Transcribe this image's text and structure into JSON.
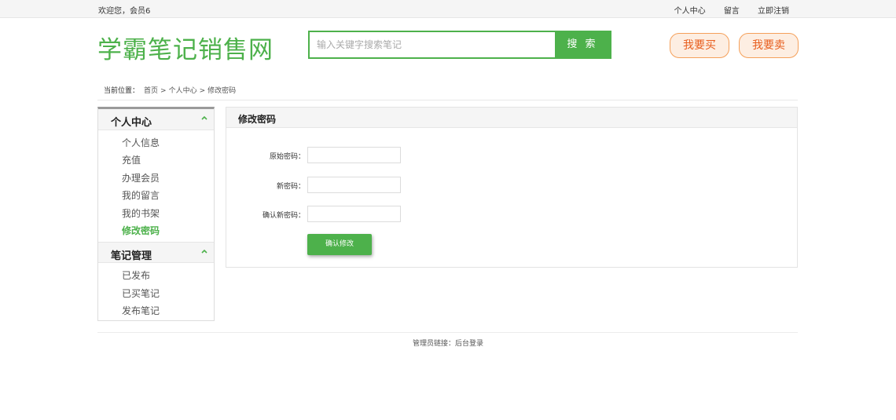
{
  "topbar": {
    "welcome": "欢迎您，会员6",
    "links": [
      "个人中心",
      "留言",
      "立即注销"
    ]
  },
  "header": {
    "logo": "学霸笔记销售网",
    "search_placeholder": "输入关键字搜索笔记",
    "search_button": "搜 索",
    "buy_button": "我要买",
    "sell_button": "我要卖"
  },
  "breadcrumb": {
    "label": "当前位置：",
    "items": [
      "首页",
      "个人中心",
      "修改密码"
    ],
    "separator": ">"
  },
  "sidebar": {
    "sections": [
      {
        "title": "个人中心",
        "items": [
          "个人信息",
          "充值",
          "办理会员",
          "我的留言",
          "我的书架",
          "修改密码"
        ],
        "active": "修改密码"
      },
      {
        "title": "笔记管理",
        "items": [
          "已发布",
          "已买笔记",
          "发布笔记"
        ]
      }
    ]
  },
  "panel": {
    "title": "修改密码",
    "fields": [
      {
        "label": "原始密码：",
        "value": ""
      },
      {
        "label": "新密码：",
        "value": ""
      },
      {
        "label": "确认新密码：",
        "value": ""
      }
    ],
    "confirm_button": "确认修改"
  },
  "footer": {
    "label": "管理员链接：",
    "link": "后台登录"
  },
  "colors": {
    "accent_green": "#4db14b",
    "orange": "#e85d1d"
  }
}
